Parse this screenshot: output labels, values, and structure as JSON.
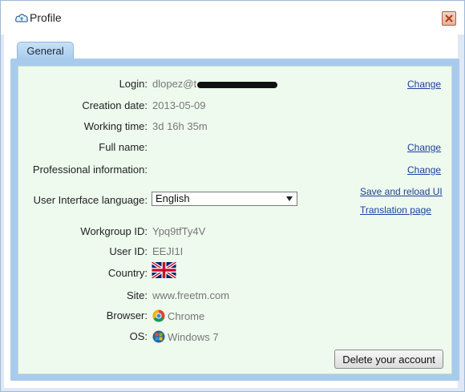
{
  "window": {
    "title": "Profile",
    "title_icon": "cloud-icon",
    "close_icon": "close-icon"
  },
  "tabs": [
    {
      "label": "General",
      "active": true
    }
  ],
  "fields": {
    "login": {
      "label": "Login:",
      "value": "dlopez@t",
      "redacted": true,
      "action": "Change"
    },
    "creation_date": {
      "label": "Creation date:",
      "value": "2013-05-09"
    },
    "working_time": {
      "label": "Working time:",
      "value": "3d 16h 35m"
    },
    "full_name": {
      "label": "Full name:",
      "value": "",
      "action": "Change"
    },
    "professional_info": {
      "label": "Professional information:",
      "value": "",
      "action": "Change"
    },
    "ui_language": {
      "label": "User Interface language:",
      "selected": "English",
      "action_save": "Save and reload UI",
      "action_translate": "Translation page"
    },
    "workgroup_id": {
      "label": "Workgroup ID:",
      "value": "Ypq9tfTy4V"
    },
    "user_id": {
      "label": "User ID:",
      "value": "EEJI1I"
    },
    "country": {
      "label": "Country:",
      "flag_icon": "uk-flag-icon"
    },
    "site": {
      "label": "Site:",
      "value": "www.freetm.com"
    },
    "browser": {
      "label": "Browser:",
      "value": "Chrome",
      "icon": "chrome-icon"
    },
    "os": {
      "label": "OS:",
      "value": "Windows 7",
      "icon": "windows-icon"
    }
  },
  "buttons": {
    "delete_account": "Delete your account"
  },
  "colors": {
    "panel_bg": "#eefaee",
    "link": "#1d3f9c",
    "tab_bg": "#b8d6f1",
    "panel_border": "#a8cbec"
  }
}
